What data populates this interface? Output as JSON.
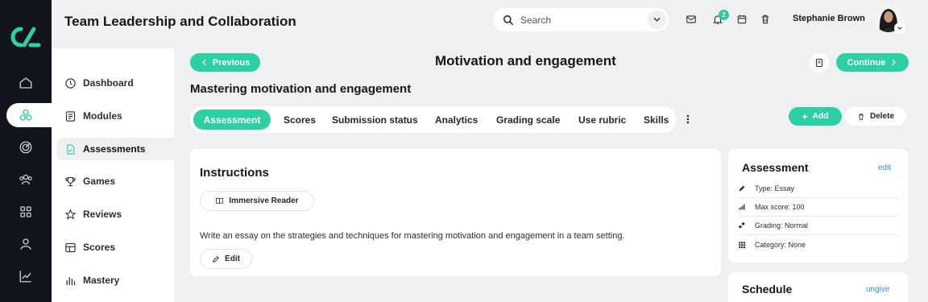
{
  "app_title": "Team Leadership and Collaboration",
  "search": {
    "placeholder": "Search"
  },
  "notifications": {
    "count": "2"
  },
  "user": {
    "name": "Stephanie Brown"
  },
  "sidebar": {
    "items": [
      {
        "label": "Dashboard",
        "icon": "dashboard-icon"
      },
      {
        "label": "Modules",
        "icon": "modules-icon"
      },
      {
        "label": "Assessments",
        "icon": "assessments-icon",
        "active": true
      },
      {
        "label": "Games",
        "icon": "trophy-icon"
      },
      {
        "label": "Reviews",
        "icon": "star-icon"
      },
      {
        "label": "Scores",
        "icon": "table-icon"
      },
      {
        "label": "Mastery",
        "icon": "bars-icon"
      }
    ]
  },
  "rail": {
    "icons": [
      "home-icon",
      "hub-icon",
      "target-icon",
      "users-icon",
      "grid-icon",
      "person-icon",
      "chart-icon"
    ],
    "active": "hub-icon"
  },
  "page": {
    "prev_label": "Previous",
    "title": "Motivation and engagement",
    "continue_label": "Continue",
    "subtitle": "Mastering motivation and engagement"
  },
  "tabs": [
    "Assessment",
    "Scores",
    "Submission status",
    "Analytics",
    "Grading scale",
    "Use rubric",
    "Skills"
  ],
  "actions": {
    "add_label": "Add",
    "delete_label": "Delete"
  },
  "instructions": {
    "title": "Instructions",
    "reader_label": "Immersive Reader",
    "text": "Write an essay on the strategies and techniques for mastering motivation and engagement in a team setting.",
    "edit_label": "Edit"
  },
  "assessment_card": {
    "title": "Assessment",
    "edit_link": "edit",
    "rows": [
      {
        "text": "Type: Essay",
        "icon": "pencil-icon"
      },
      {
        "text": "Max score: 100",
        "icon": "signal-icon"
      },
      {
        "text": "Grading: Normal",
        "icon": "grading-icon"
      },
      {
        "text": "Category: None",
        "icon": "category-icon"
      }
    ]
  },
  "schedule_card": {
    "title": "Schedule",
    "link": "ungive"
  },
  "colors": {
    "accent": "#2dcfa5",
    "rail": "#11141c",
    "link": "#2e8fd8",
    "background": "#eef0f2"
  }
}
